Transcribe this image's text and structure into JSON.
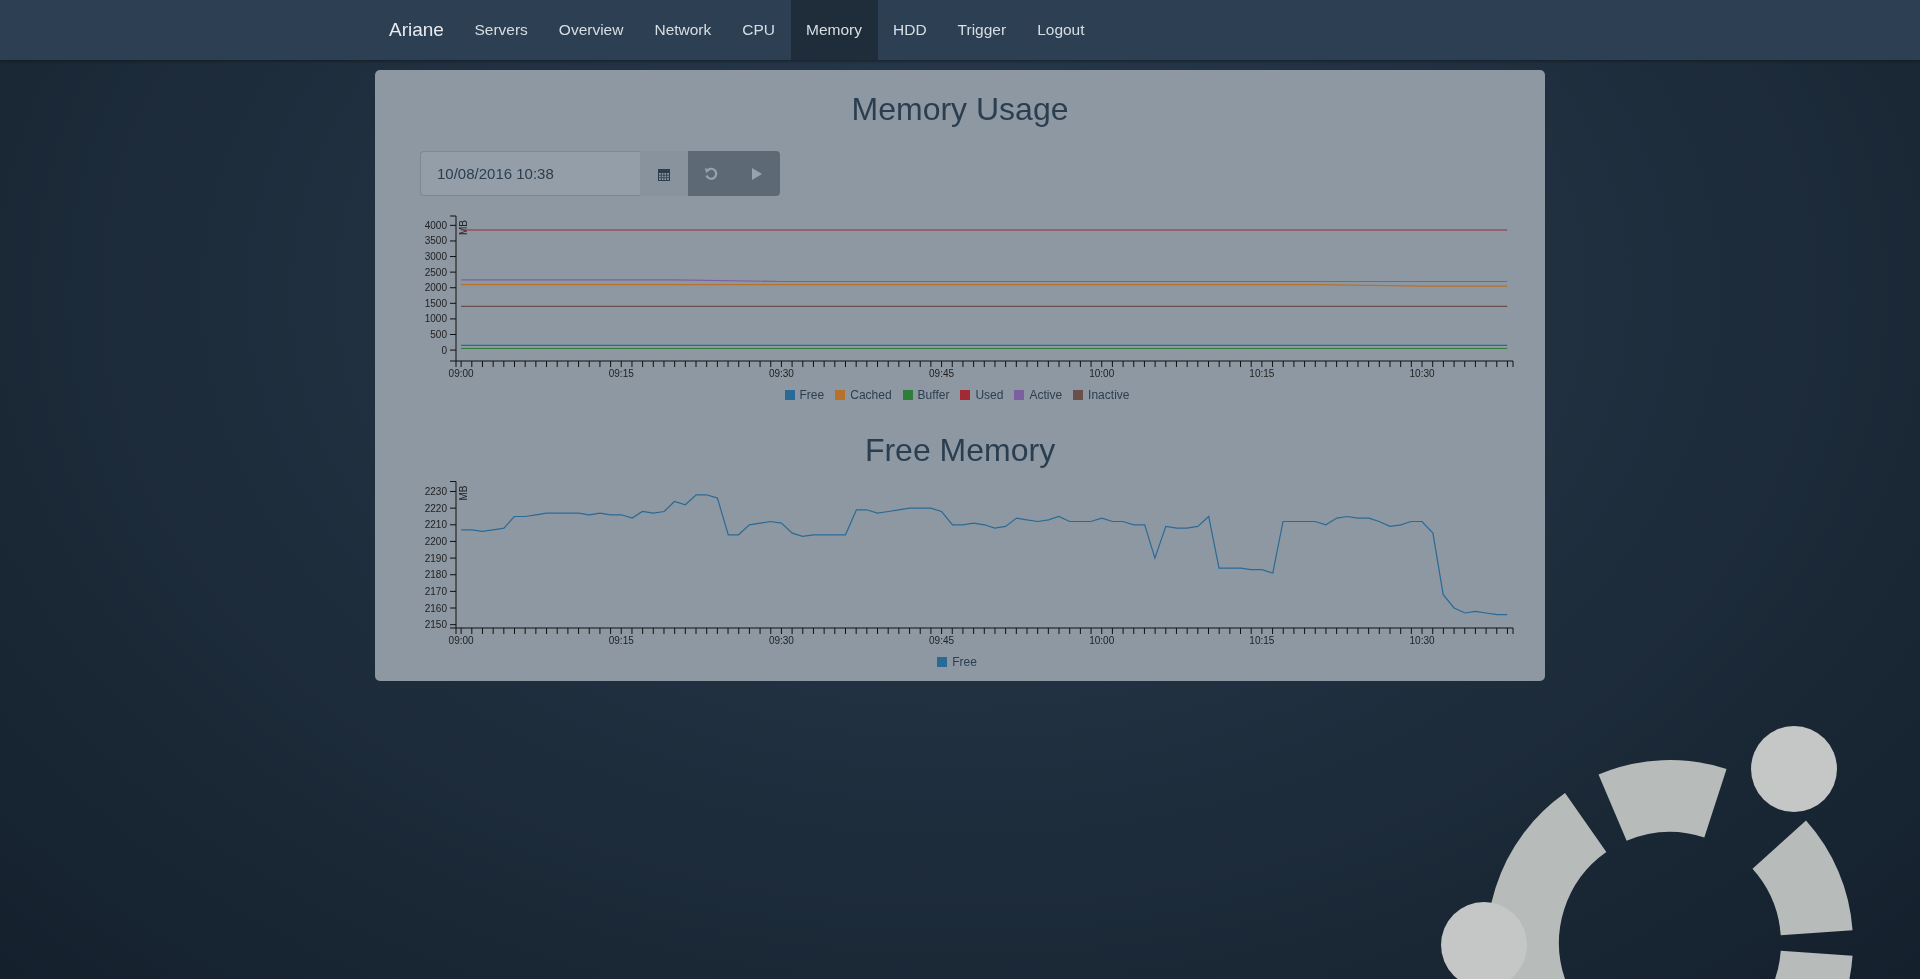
{
  "navbar": {
    "brand": "Ariane",
    "items": [
      {
        "label": "Servers",
        "selected": false
      },
      {
        "label": "Overview",
        "selected": false
      },
      {
        "label": "Network",
        "selected": false
      },
      {
        "label": "CPU",
        "selected": false
      },
      {
        "label": "Memory",
        "selected": true
      },
      {
        "label": "HDD",
        "selected": false
      },
      {
        "label": "Trigger",
        "selected": false
      },
      {
        "label": "Logout",
        "selected": false
      }
    ]
  },
  "sections": [
    {
      "heading": "Memory Usage",
      "controls": {
        "date_field": {
          "value": "10/08/2016 10:38"
        },
        "buttons": [
          {
            "kind": "calendar"
          },
          {
            "kind": "refresh"
          },
          {
            "kind": "play"
          }
        ]
      },
      "chart_data": {
        "type": "line",
        "ylabel": "MB",
        "x": [
          9,
          9.167,
          9.333,
          9.5,
          9.667,
          9.833,
          10,
          10.167,
          10.333,
          10.5,
          10.633
        ],
        "xlim": [
          8.992,
          10.642
        ],
        "ylim": [
          -350,
          4300
        ],
        "xticks": [
          {
            "value": 9,
            "label": "09:00"
          },
          {
            "value": 9.25,
            "label": "09:15"
          },
          {
            "value": 9.5,
            "label": "09:30"
          },
          {
            "value": 9.75,
            "label": "09:45"
          },
          {
            "value": 10,
            "label": "10:00"
          },
          {
            "value": 10.25,
            "label": "10:15"
          },
          {
            "value": 10.5,
            "label": "10:30"
          }
        ],
        "yticks": [
          0,
          500,
          1000,
          1500,
          2000,
          2500,
          3000,
          3500,
          4000
        ],
        "series": [
          {
            "name": "Free",
            "color": "#2a6a96",
            "values": [
              150,
              150,
              150,
              150,
              150,
              150,
              150,
              150,
              150,
              150,
              150
            ]
          },
          {
            "name": "Cached",
            "color": "#b8712a",
            "values": [
              2100,
              2100,
              2100,
              2100,
              2100,
              2100,
              2100,
              2100,
              2100,
              2050,
              2050
            ]
          },
          {
            "name": "Buffer",
            "color": "#2e7d3a",
            "values": [
              50,
              50,
              50,
              50,
              50,
              50,
              50,
              50,
              50,
              50,
              50
            ]
          },
          {
            "name": "Used",
            "color": "#a32a35",
            "values": [
              3850,
              3850,
              3850,
              3850,
              3850,
              3850,
              3850,
              3850,
              3850,
              3850,
              3850
            ]
          },
          {
            "name": "Active",
            "color": "#7b5fa0",
            "values": [
              2250,
              2250,
              2250,
              2200,
              2200,
              2200,
              2200,
              2200,
              2200,
              2200,
              2200
            ]
          },
          {
            "name": "Inactive",
            "color": "#6b4f4a",
            "values": [
              1400,
              1400,
              1400,
              1400,
              1400,
              1400,
              1400,
              1400,
              1400,
              1400,
              1400
            ]
          }
        ]
      }
    },
    {
      "heading": "Free Memory",
      "chart_data": {
        "type": "line",
        "ylabel": "MB",
        "x": [
          9,
          9.017,
          9.033,
          9.05,
          9.067,
          9.083,
          9.1,
          9.117,
          9.133,
          9.15,
          9.167,
          9.183,
          9.2,
          9.217,
          9.233,
          9.25,
          9.267,
          9.283,
          9.3,
          9.317,
          9.333,
          9.35,
          9.367,
          9.383,
          9.4,
          9.417,
          9.433,
          9.45,
          9.467,
          9.483,
          9.5,
          9.517,
          9.533,
          9.55,
          9.567,
          9.583,
          9.6,
          9.617,
          9.633,
          9.65,
          9.667,
          9.683,
          9.7,
          9.717,
          9.733,
          9.75,
          9.767,
          9.783,
          9.8,
          9.817,
          9.833,
          9.85,
          9.867,
          9.883,
          9.9,
          9.917,
          9.933,
          9.95,
          9.967,
          9.983,
          10,
          10.017,
          10.033,
          10.05,
          10.067,
          10.083,
          10.1,
          10.117,
          10.133,
          10.15,
          10.167,
          10.183,
          10.2,
          10.217,
          10.233,
          10.25,
          10.267,
          10.283,
          10.3,
          10.317,
          10.333,
          10.35,
          10.367,
          10.383,
          10.4,
          10.417,
          10.433,
          10.45,
          10.467,
          10.483,
          10.5,
          10.517,
          10.533,
          10.55,
          10.567,
          10.583,
          10.6,
          10.617,
          10.633
        ],
        "xlim": [
          8.992,
          10.642
        ],
        "ylim": [
          2148,
          2236
        ],
        "xticks": [
          {
            "value": 9,
            "label": "09:00"
          },
          {
            "value": 9.25,
            "label": "09:15"
          },
          {
            "value": 9.5,
            "label": "09:30"
          },
          {
            "value": 9.75,
            "label": "09:45"
          },
          {
            "value": 10,
            "label": "10:00"
          },
          {
            "value": 10.25,
            "label": "10:15"
          },
          {
            "value": 10.5,
            "label": "10:30"
          }
        ],
        "yticks": [
          2150,
          2160,
          2170,
          2180,
          2190,
          2200,
          2210,
          2220,
          2230
        ],
        "series": [
          {
            "name": "Free",
            "color": "#2a6a96",
            "values": [
              2207,
              2207,
              2206,
              2207,
              2208,
              2215,
              2215,
              2216,
              2217,
              2217,
              2217,
              2217,
              2216,
              2217,
              2216,
              2216,
              2214,
              2218,
              2217,
              2218,
              2224,
              2222,
              2228,
              2228,
              2226,
              2204,
              2204,
              2210,
              2211,
              2212,
              2211,
              2205,
              2203,
              2204,
              2204,
              2204,
              2204,
              2219,
              2219,
              2217,
              2218,
              2219,
              2220,
              2220,
              2220,
              2218,
              2210,
              2210,
              2211,
              2210,
              2208,
              2209,
              2214,
              2213,
              2212,
              2213,
              2215,
              2212,
              2212,
              2212,
              2214,
              2212,
              2212,
              2210,
              2210,
              2190,
              2209,
              2208,
              2208,
              2209,
              2215,
              2184,
              2184,
              2184,
              2183,
              2183,
              2181,
              2212,
              2212,
              2212,
              2212,
              2210,
              2214,
              2215,
              2214,
              2214,
              2212,
              2209,
              2210,
              2212,
              2212,
              2205,
              2168,
              2160,
              2157,
              2158,
              2157,
              2156,
              2156
            ]
          }
        ]
      }
    }
  ]
}
